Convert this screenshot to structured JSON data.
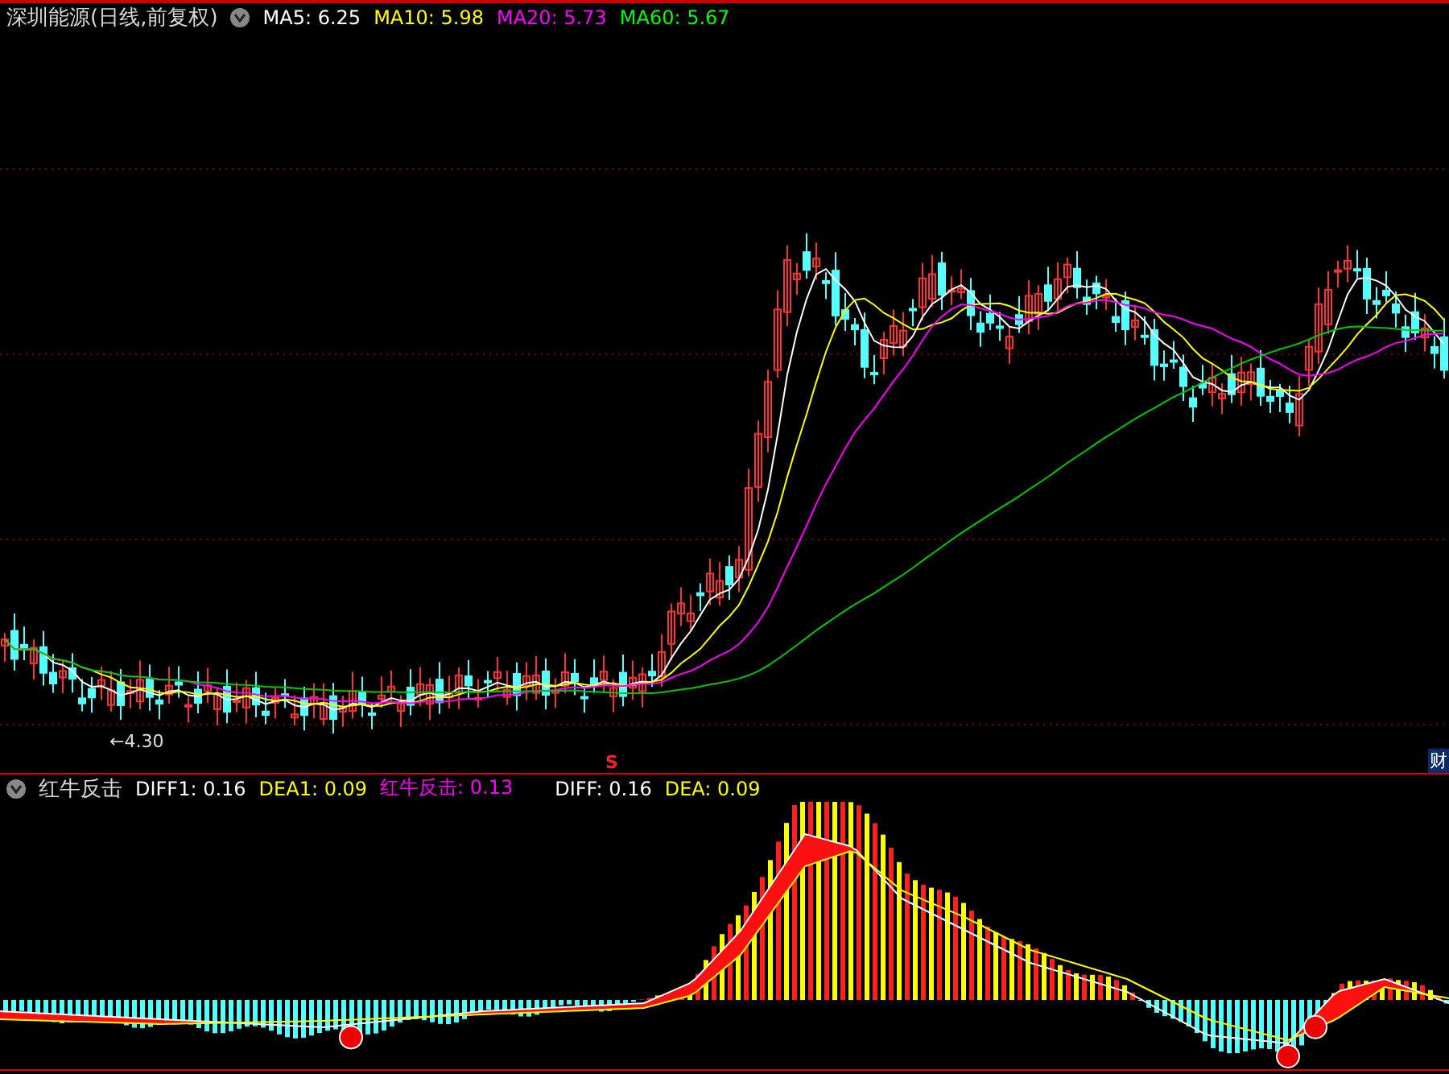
{
  "title": "深圳能源(日线,前复权)",
  "ma": [
    {
      "label": "MA5: 6.25",
      "color": "#ffffff"
    },
    {
      "label": "MA10: 5.98",
      "color": "#ffff00"
    },
    {
      "label": "MA20: 5.73",
      "color": "#ff00ff"
    },
    {
      "label": "MA60: 5.67",
      "color": "#00ff00"
    }
  ],
  "price_panel": {
    "low_label": "←4.30",
    "signal_marker": "S",
    "right_edge_tag": "财"
  },
  "indicator": {
    "name": "红牛反击",
    "values": [
      {
        "label": "DIFF1: 0.16",
        "color": "#ffffff"
      },
      {
        "label": "DEA1: 0.09",
        "color": "#ffff00"
      },
      {
        "label": "红牛反击: 0.13",
        "color": "#ff00ff"
      },
      {
        "label": "DIFF: 0.16",
        "color": "#ffffff"
      },
      {
        "label": "DEA: 0.09",
        "color": "#ffff00"
      }
    ]
  }
}
